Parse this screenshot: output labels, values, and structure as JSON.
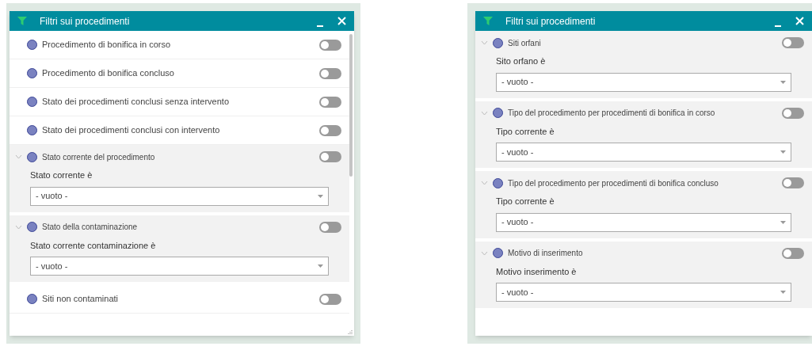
{
  "panels": [
    {
      "title": "Filtri sui procedimenti",
      "items": [
        {
          "kind": "toggle",
          "label": "Procedimento di bonifica in corso",
          "on": false
        },
        {
          "kind": "toggle",
          "label": "Procedimento di bonifica concluso",
          "on": false
        },
        {
          "kind": "toggle",
          "label": "Stato dei procedimenti conclusi senza intervento",
          "on": false
        },
        {
          "kind": "toggle",
          "label": "Stato dei procedimenti conclusi con intervento",
          "on": false
        },
        {
          "kind": "filter",
          "label": "Stato corrente del procedimento",
          "on": false,
          "expanded": true,
          "field_label": "Stato corrente è",
          "value": "- vuoto -"
        },
        {
          "kind": "filter",
          "label": "Stato della contaminazione",
          "on": false,
          "expanded": true,
          "field_label": "Stato corrente contaminazione è",
          "value": "- vuoto -"
        },
        {
          "kind": "toggle",
          "label": "Siti non contaminati",
          "on": false
        }
      ]
    },
    {
      "title": "Filtri sui procedimenti",
      "items": [
        {
          "kind": "filter",
          "label": "Siti orfani",
          "on": false,
          "expanded": true,
          "field_label": "Sito orfano è",
          "value": "- vuoto -"
        },
        {
          "kind": "filter",
          "label": "Tipo del procedimento per procedimenti di bonifica in corso",
          "on": false,
          "expanded": true,
          "field_label": "Tipo corrente è",
          "value": "- vuoto -"
        },
        {
          "kind": "filter",
          "label": "Tipo del procedimento per procedimenti di bonifica concluso",
          "on": false,
          "expanded": true,
          "field_label": "Tipo corrente è",
          "value": "- vuoto -"
        },
        {
          "kind": "filter",
          "label": "Motivo di inserimento",
          "on": false,
          "expanded": true,
          "field_label": "Motivo inserimento è",
          "value": "- vuoto -"
        }
      ]
    }
  ]
}
